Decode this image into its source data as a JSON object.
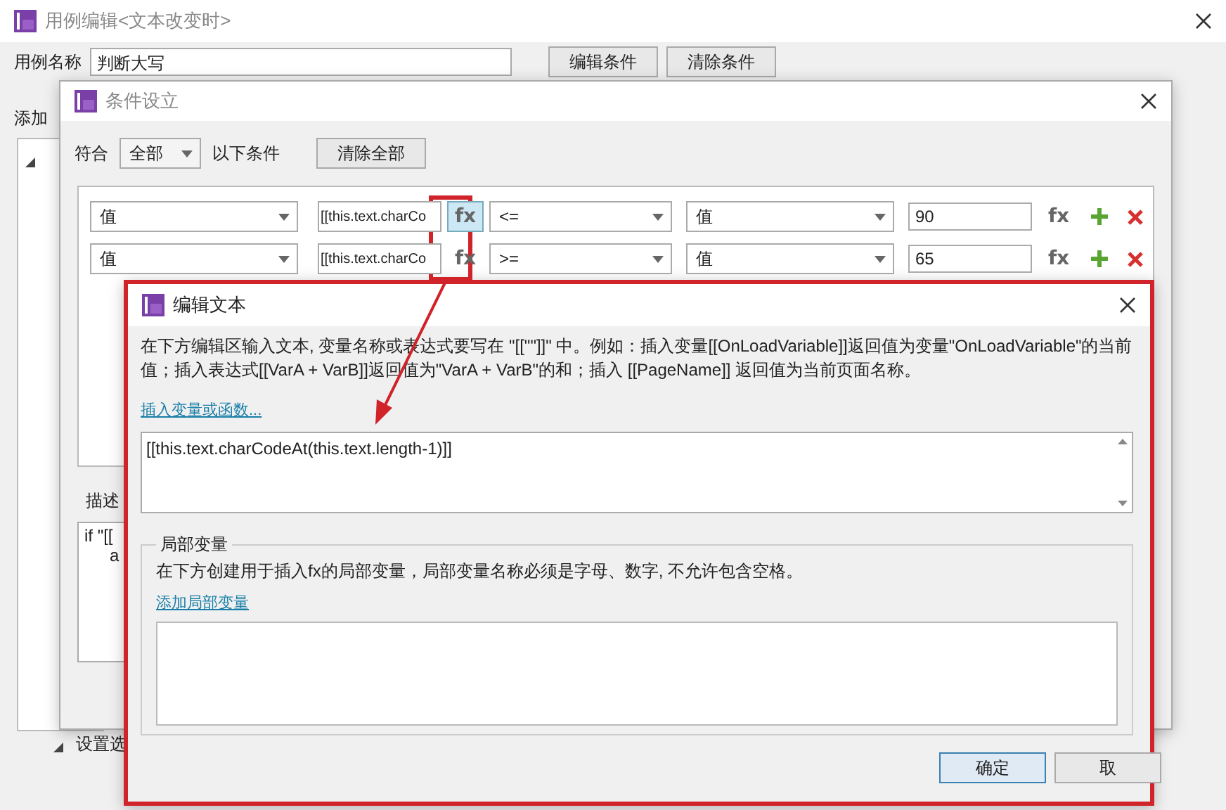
{
  "main_window": {
    "title": "用例编辑<文本改变时>",
    "case_name_label": "用例名称",
    "case_name_value": "判断大写",
    "buttons": [
      "编辑条件",
      "清除条件"
    ],
    "add_label": "添加",
    "settings_label": "设置选"
  },
  "condition_window": {
    "title": "条件设立",
    "match_label": "符合",
    "match_value": "全部",
    "match_suffix": "以下条件",
    "clear_all_button": "清除全部",
    "rows": [
      {
        "left": "值",
        "expression": "[[this.text.charCo",
        "fx": "fx",
        "fx_hovered": true,
        "operator": "<=",
        "right": "值",
        "value": "90",
        "value_fx": "fx"
      },
      {
        "left": "值",
        "expression": "[[this.text.charCo",
        "fx": "fx",
        "fx_hovered": false,
        "operator": ">=",
        "right": "值",
        "value": "65",
        "value_fx": "fx"
      }
    ],
    "description_label": "描述",
    "description_lines": [
      "if \"[[",
      "a"
    ]
  },
  "edit_dialog": {
    "title": "编辑文本",
    "instructions": "在下方编辑区输入文本, 变量名称或表达式要写在 \"[[\"\"]]\" 中。例如：插入变量[[OnLoadVariable]]返回值为变量\"OnLoadVariable\"的当前值；插入表达式[[VarA + VarB]]返回值为\"VarA + VarB\"的和；插入 [[PageName]] 返回值为当前页面名称。",
    "insert_link": "插入变量或函数...",
    "editor_value": "[[this.text.charCodeAt(this.text.length-1)]]",
    "local_vars": {
      "legend": "局部变量",
      "hint": "在下方创建用于插入fx的局部变量，局部变量名称必须是字母、数字, 不允许包含空格。",
      "add_link": "添加局部变量"
    },
    "buttons": [
      {
        "label": "确定",
        "kind": "default"
      },
      {
        "label": "取",
        "kind": "normal"
      }
    ]
  }
}
